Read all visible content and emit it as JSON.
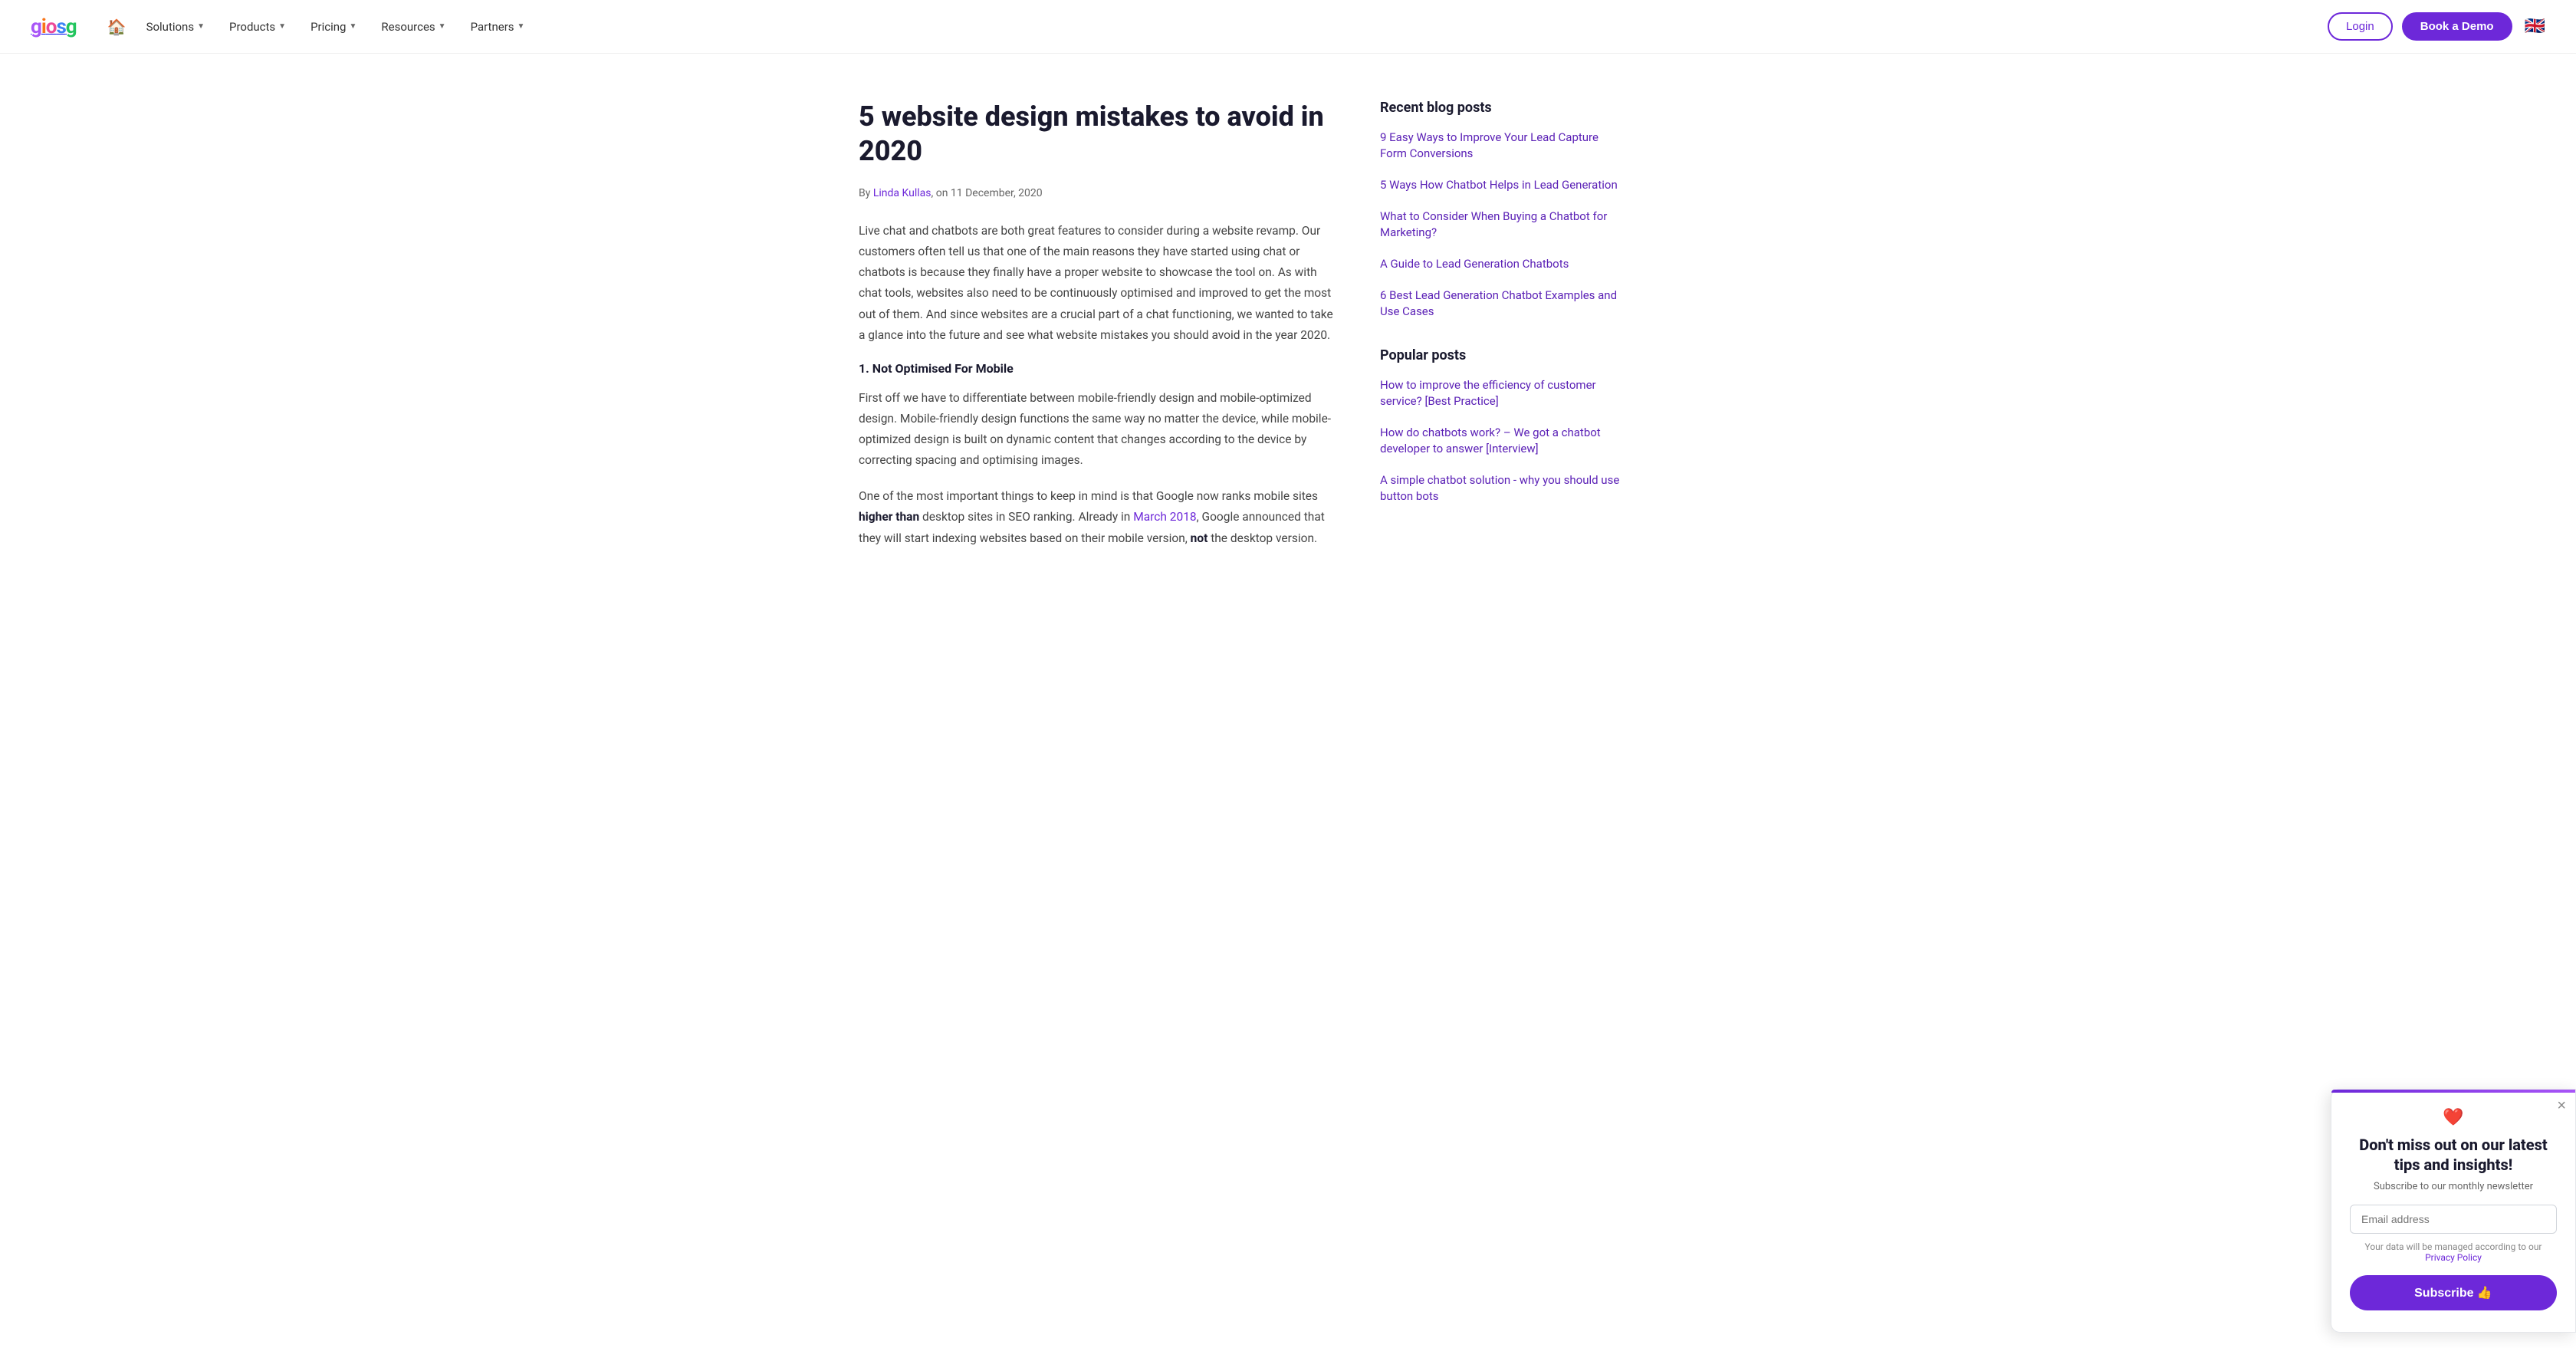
{
  "nav": {
    "logo_letters": [
      "g",
      "i",
      "o",
      "s",
      "g"
    ],
    "home_icon": "🏠",
    "items": [
      {
        "label": "Solutions",
        "has_dropdown": true
      },
      {
        "label": "Products",
        "has_dropdown": true
      },
      {
        "label": "Pricing",
        "has_dropdown": true
      },
      {
        "label": "Resources",
        "has_dropdown": true
      },
      {
        "label": "Partners",
        "has_dropdown": true
      }
    ],
    "login_label": "Login",
    "demo_label": "Book a Demo",
    "flag": "🇬🇧"
  },
  "article": {
    "title": "5 website design mistakes to avoid in 2020",
    "meta_by": "By ",
    "meta_author": "Linda Kullas",
    "meta_date": ", on 11 December, 2020",
    "section1_heading": "1. Not Optimised For Mobile",
    "paragraphs": [
      "Live chat and chatbots are both great features to consider during a website revamp. Our customers often tell us that one of the main reasons they have started using chat or chatbots is because they finally have a proper website to showcase the tool on. As with chat tools, websites also need to be continuously optimised and improved to get the most out of them. And since websites are a crucial part of a chat functioning, we wanted to take a glance into the future and see what website mistakes you should avoid in the year 2020.",
      "First off we have to differentiate between mobile-friendly design and mobile-optimized design. Mobile-friendly design functions the same way no matter the device, while mobile-optimized design is built on dynamic content that changes according to the device by correcting spacing and optimising images.",
      "One of the most important things to keep in mind is that Google now ranks mobile sites higher than desktop sites in SEO ranking. Already in March 2018, Google announced that they will start indexing websites based on their mobile version, not the desktop version."
    ],
    "p2_link_text": "March 2018",
    "p2_bold1": "higher than",
    "p2_bold2": "not"
  },
  "sidebar": {
    "recent_heading": "Recent blog posts",
    "recent_links": [
      "9 Easy Ways to Improve Your Lead Capture Form Conversions",
      "5 Ways How Chatbot Helps in Lead Generation",
      "What to Consider When Buying a Chatbot for Marketing?",
      "A Guide to Lead Generation Chatbots",
      "6 Best Lead Generation Chatbot Examples and Use Cases"
    ],
    "popular_heading": "Popular posts",
    "popular_links": [
      "How to improve the efficiency of customer service? [Best Practice]",
      "How do chatbots work? – We got a chatbot developer to answer [Interview]",
      "A simple chatbot solution - why you should use button bots"
    ]
  },
  "popup": {
    "heart": "❤️",
    "title": "Don't miss out on our latest tips and insights!",
    "subtitle": "Subscribe to our monthly newsletter",
    "input_placeholder": "Email address",
    "privacy_text": "Your data will be managed according to our",
    "privacy_link": "Privacy Policy",
    "btn_label": "Subscribe 👍",
    "close": "×"
  }
}
